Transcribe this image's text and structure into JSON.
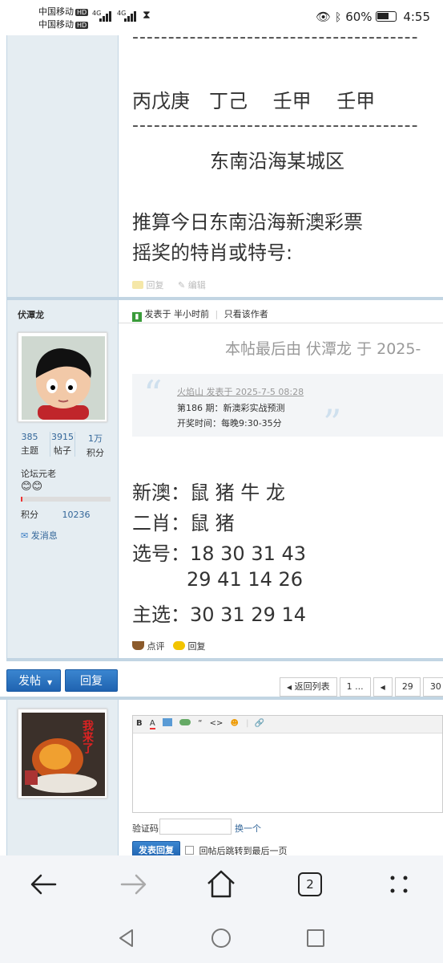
{
  "status_bar": {
    "carrier1": "中国移动",
    "carrier2": "中国移动",
    "hd": "HD",
    "net": "4G",
    "battery": "60%",
    "time": "4:55"
  },
  "post1": {
    "dashes": "----------------------------------------",
    "line_stems": "丙戊庚　丁己　 壬甲　  壬甲",
    "location": "东南沿海某城区",
    "question_line1": "推算今日东南沿海新澳彩票",
    "question_line2": "摇奖的特肖或特号:",
    "reply_label": "回复",
    "edit_label": "编辑"
  },
  "post2": {
    "author": "伏潭龙",
    "posted_at": "发表于 半小时前",
    "only_author": "只看该作者",
    "edit_note": "本帖最后由 伏潭龙 于 2025-",
    "stats": [
      {
        "num": "385",
        "label": "主题"
      },
      {
        "num": "3915",
        "label": "帖子"
      },
      {
        "num": "1万",
        "label": "积分"
      }
    ],
    "rank": "论坛元老",
    "points_label": "积分",
    "points_value": "10236",
    "send_msg": "发消息",
    "quote_header": "火焰山 发表于 2025-7-5 08:28",
    "quote_line1": "第186 期：新澳彩实战预测",
    "quote_line2": "开奖时间：每晚9:30-35分",
    "body_line1": "新澳：鼠  猪  牛  龙",
    "body_line2": "二肖：鼠  猪",
    "body_line3": "选号：18 30 31 43",
    "body_line4": "29 41 14 26",
    "body_line5": "主选：30 31 29 14",
    "rate_label": "点评",
    "reply_label": "回复"
  },
  "pager": {
    "post_btn": "发帖",
    "reply_btn": "回复",
    "back_list": "返回列表",
    "page_first": "1 ...",
    "page_29": "29",
    "page_30": "30"
  },
  "reply_form": {
    "avatar_text": "我来了",
    "toolbar": [
      "B",
      "A",
      "img",
      "link",
      "“",
      "<>",
      "☻",
      "attach"
    ],
    "captcha_label": "验证码",
    "captcha_change": "换一个",
    "submit": "发表回复",
    "jump_last": "回帖后跳转到最后一页"
  },
  "browser_nav": {
    "tab_count": "2"
  }
}
